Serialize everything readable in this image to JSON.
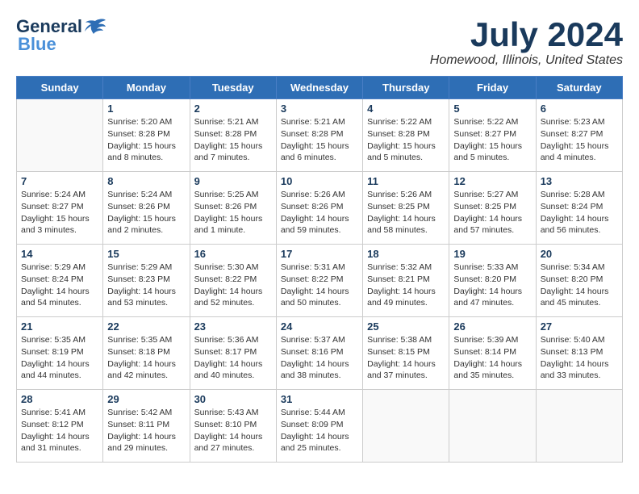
{
  "logo": {
    "general": "General",
    "blue": "Blue"
  },
  "title": "July 2024",
  "location": "Homewood, Illinois, United States",
  "days_of_week": [
    "Sunday",
    "Monday",
    "Tuesday",
    "Wednesday",
    "Thursday",
    "Friday",
    "Saturday"
  ],
  "weeks": [
    [
      {
        "day": "",
        "info": ""
      },
      {
        "day": "1",
        "info": "Sunrise: 5:20 AM\nSunset: 8:28 PM\nDaylight: 15 hours\nand 8 minutes."
      },
      {
        "day": "2",
        "info": "Sunrise: 5:21 AM\nSunset: 8:28 PM\nDaylight: 15 hours\nand 7 minutes."
      },
      {
        "day": "3",
        "info": "Sunrise: 5:21 AM\nSunset: 8:28 PM\nDaylight: 15 hours\nand 6 minutes."
      },
      {
        "day": "4",
        "info": "Sunrise: 5:22 AM\nSunset: 8:28 PM\nDaylight: 15 hours\nand 5 minutes."
      },
      {
        "day": "5",
        "info": "Sunrise: 5:22 AM\nSunset: 8:27 PM\nDaylight: 15 hours\nand 5 minutes."
      },
      {
        "day": "6",
        "info": "Sunrise: 5:23 AM\nSunset: 8:27 PM\nDaylight: 15 hours\nand 4 minutes."
      }
    ],
    [
      {
        "day": "7",
        "info": "Sunrise: 5:24 AM\nSunset: 8:27 PM\nDaylight: 15 hours\nand 3 minutes."
      },
      {
        "day": "8",
        "info": "Sunrise: 5:24 AM\nSunset: 8:26 PM\nDaylight: 15 hours\nand 2 minutes."
      },
      {
        "day": "9",
        "info": "Sunrise: 5:25 AM\nSunset: 8:26 PM\nDaylight: 15 hours\nand 1 minute."
      },
      {
        "day": "10",
        "info": "Sunrise: 5:26 AM\nSunset: 8:26 PM\nDaylight: 14 hours\nand 59 minutes."
      },
      {
        "day": "11",
        "info": "Sunrise: 5:26 AM\nSunset: 8:25 PM\nDaylight: 14 hours\nand 58 minutes."
      },
      {
        "day": "12",
        "info": "Sunrise: 5:27 AM\nSunset: 8:25 PM\nDaylight: 14 hours\nand 57 minutes."
      },
      {
        "day": "13",
        "info": "Sunrise: 5:28 AM\nSunset: 8:24 PM\nDaylight: 14 hours\nand 56 minutes."
      }
    ],
    [
      {
        "day": "14",
        "info": "Sunrise: 5:29 AM\nSunset: 8:24 PM\nDaylight: 14 hours\nand 54 minutes."
      },
      {
        "day": "15",
        "info": "Sunrise: 5:29 AM\nSunset: 8:23 PM\nDaylight: 14 hours\nand 53 minutes."
      },
      {
        "day": "16",
        "info": "Sunrise: 5:30 AM\nSunset: 8:22 PM\nDaylight: 14 hours\nand 52 minutes."
      },
      {
        "day": "17",
        "info": "Sunrise: 5:31 AM\nSunset: 8:22 PM\nDaylight: 14 hours\nand 50 minutes."
      },
      {
        "day": "18",
        "info": "Sunrise: 5:32 AM\nSunset: 8:21 PM\nDaylight: 14 hours\nand 49 minutes."
      },
      {
        "day": "19",
        "info": "Sunrise: 5:33 AM\nSunset: 8:20 PM\nDaylight: 14 hours\nand 47 minutes."
      },
      {
        "day": "20",
        "info": "Sunrise: 5:34 AM\nSunset: 8:20 PM\nDaylight: 14 hours\nand 45 minutes."
      }
    ],
    [
      {
        "day": "21",
        "info": "Sunrise: 5:35 AM\nSunset: 8:19 PM\nDaylight: 14 hours\nand 44 minutes."
      },
      {
        "day": "22",
        "info": "Sunrise: 5:35 AM\nSunset: 8:18 PM\nDaylight: 14 hours\nand 42 minutes."
      },
      {
        "day": "23",
        "info": "Sunrise: 5:36 AM\nSunset: 8:17 PM\nDaylight: 14 hours\nand 40 minutes."
      },
      {
        "day": "24",
        "info": "Sunrise: 5:37 AM\nSunset: 8:16 PM\nDaylight: 14 hours\nand 38 minutes."
      },
      {
        "day": "25",
        "info": "Sunrise: 5:38 AM\nSunset: 8:15 PM\nDaylight: 14 hours\nand 37 minutes."
      },
      {
        "day": "26",
        "info": "Sunrise: 5:39 AM\nSunset: 8:14 PM\nDaylight: 14 hours\nand 35 minutes."
      },
      {
        "day": "27",
        "info": "Sunrise: 5:40 AM\nSunset: 8:13 PM\nDaylight: 14 hours\nand 33 minutes."
      }
    ],
    [
      {
        "day": "28",
        "info": "Sunrise: 5:41 AM\nSunset: 8:12 PM\nDaylight: 14 hours\nand 31 minutes."
      },
      {
        "day": "29",
        "info": "Sunrise: 5:42 AM\nSunset: 8:11 PM\nDaylight: 14 hours\nand 29 minutes."
      },
      {
        "day": "30",
        "info": "Sunrise: 5:43 AM\nSunset: 8:10 PM\nDaylight: 14 hours\nand 27 minutes."
      },
      {
        "day": "31",
        "info": "Sunrise: 5:44 AM\nSunset: 8:09 PM\nDaylight: 14 hours\nand 25 minutes."
      },
      {
        "day": "",
        "info": ""
      },
      {
        "day": "",
        "info": ""
      },
      {
        "day": "",
        "info": ""
      }
    ]
  ]
}
